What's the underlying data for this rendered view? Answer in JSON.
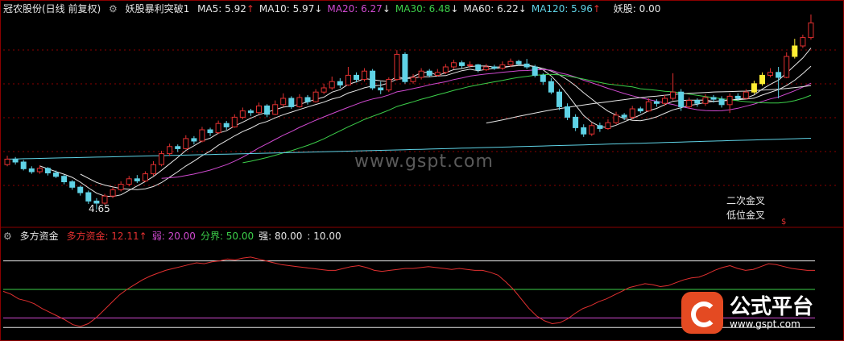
{
  "header": {
    "title": "冠农股份(日线 前复权)",
    "indicator_name": "妖股暴利突破1",
    "ma_items": [
      {
        "label": "MA5: 5.92",
        "arrow": "↑",
        "color": "#e6e6e6"
      },
      {
        "label": "MA10: 5.97",
        "arrow": "↓",
        "color": "#e6e6e6"
      },
      {
        "label": "MA20: 6.27",
        "arrow": "↓",
        "color": "#d04ad0"
      },
      {
        "label": "MA30: 6.48",
        "arrow": "↓",
        "color": "#3ccf4a"
      },
      {
        "label": "MA60: 6.22",
        "arrow": "↓",
        "color": "#e6e6e6"
      },
      {
        "label": "MA120: 5.96",
        "arrow": "↑",
        "color": "#5fd3e6"
      }
    ],
    "yaogu": "妖股: 0.00"
  },
  "sub_header": {
    "indicator_name": "多方资金",
    "items": [
      {
        "label": "多方资金: 12.11",
        "arrow": "↑",
        "color": "#e23030"
      },
      {
        "label": "弱: 20.00",
        "arrow": "",
        "color": "#d04ad0"
      },
      {
        "label": "分界: 50.00",
        "arrow": "",
        "color": "#3ccf4a"
      },
      {
        "label": "强: 80.00",
        "arrow": "",
        "color": "#e6e6e6"
      },
      {
        "label": ": 10.00",
        "arrow": "",
        "color": "#e6e6e6"
      }
    ]
  },
  "annotations": {
    "low_price": "4.65",
    "signal_1": "二次金叉",
    "signal_2": "低位金叉",
    "dollar": "$"
  },
  "watermark": "www.gspt.com",
  "logo": {
    "name": "公式平台",
    "url": "www.gspt.com"
  },
  "colors": {
    "up": "#e23030",
    "down": "#5fd3e6",
    "signal": "#ffee33",
    "grid": "#8b0000"
  },
  "chart_data": {
    "type": "candlestick",
    "price_range": [
      4.3,
      9.3
    ],
    "candles": [
      [
        5.72,
        5.85,
        5.93,
        5.68
      ],
      [
        5.85,
        5.78,
        5.9,
        5.72
      ],
      [
        5.78,
        5.62,
        5.83,
        5.58
      ],
      [
        5.62,
        5.55,
        5.68,
        5.5
      ],
      [
        5.55,
        5.63,
        5.7,
        5.5
      ],
      [
        5.63,
        5.52,
        5.66,
        5.46
      ],
      [
        5.52,
        5.44,
        5.58,
        5.4
      ],
      [
        5.44,
        5.31,
        5.48,
        5.25
      ],
      [
        5.31,
        5.18,
        5.35,
        5.12
      ],
      [
        5.18,
        5.05,
        5.22,
        4.98
      ],
      [
        5.05,
        4.85,
        5.1,
        4.78
      ],
      [
        4.85,
        4.8,
        4.92,
        4.65
      ],
      [
        4.8,
        4.97,
        5.02,
        4.76
      ],
      [
        4.97,
        5.12,
        5.18,
        4.92
      ],
      [
        5.12,
        5.25,
        5.32,
        5.08
      ],
      [
        5.25,
        5.38,
        5.45,
        5.2
      ],
      [
        5.38,
        5.33,
        5.47,
        5.28
      ],
      [
        5.33,
        5.5,
        5.56,
        5.3
      ],
      [
        5.5,
        5.72,
        5.8,
        5.45
      ],
      [
        5.72,
        5.98,
        6.05,
        5.68
      ],
      [
        5.98,
        6.15,
        6.22,
        5.92
      ],
      [
        6.15,
        6.1,
        6.2,
        6.02
      ],
      [
        6.1,
        6.34,
        6.42,
        6.08
      ],
      [
        6.34,
        6.28,
        6.4,
        6.2
      ],
      [
        6.28,
        6.55,
        6.62,
        6.25
      ],
      [
        6.55,
        6.48,
        6.6,
        6.4
      ],
      [
        6.48,
        6.7,
        6.77,
        6.45
      ],
      [
        6.7,
        6.62,
        6.76,
        6.55
      ],
      [
        6.62,
        6.85,
        6.92,
        6.6
      ],
      [
        6.85,
        7.0,
        7.08,
        6.8
      ],
      [
        7.0,
        6.96,
        7.05,
        6.88
      ],
      [
        6.96,
        7.12,
        7.2,
        6.92
      ],
      [
        7.12,
        6.92,
        7.16,
        6.85
      ],
      [
        6.92,
        7.15,
        7.25,
        6.9
      ],
      [
        7.15,
        7.3,
        7.42,
        7.1
      ],
      [
        7.3,
        7.1,
        7.35,
        7.05
      ],
      [
        7.1,
        7.32,
        7.4,
        7.08
      ],
      [
        7.32,
        7.22,
        7.38,
        7.15
      ],
      [
        7.22,
        7.45,
        7.52,
        7.2
      ],
      [
        7.45,
        7.55,
        7.65,
        7.4
      ],
      [
        7.55,
        7.7,
        7.82,
        7.5
      ],
      [
        7.7,
        7.62,
        7.78,
        7.55
      ],
      [
        7.62,
        7.85,
        8.05,
        7.6
      ],
      [
        7.85,
        7.75,
        7.92,
        7.68
      ],
      [
        7.75,
        7.95,
        8.02,
        7.7
      ],
      [
        7.95,
        7.55,
        8.0,
        7.5
      ],
      [
        7.55,
        7.5,
        7.7,
        7.4
      ],
      [
        7.5,
        7.75,
        7.8,
        7.45
      ],
      [
        7.75,
        8.35,
        8.45,
        7.72
      ],
      [
        8.35,
        7.7,
        8.4,
        7.65
      ],
      [
        7.7,
        7.8,
        7.88,
        7.65
      ],
      [
        7.8,
        7.95,
        8.02,
        7.75
      ],
      [
        7.95,
        7.85,
        8.0,
        7.8
      ],
      [
        7.85,
        7.92,
        8.0,
        7.82
      ],
      [
        7.92,
        8.05,
        8.12,
        7.88
      ],
      [
        8.05,
        8.15,
        8.22,
        8.0
      ],
      [
        8.15,
        8.08,
        8.2,
        8.02
      ],
      [
        8.08,
        8.1,
        8.18,
        8.03
      ],
      [
        8.1,
        7.98,
        8.12,
        7.92
      ],
      [
        7.98,
        8.05,
        8.12,
        7.95
      ],
      [
        8.05,
        8.02,
        8.1,
        7.98
      ],
      [
        8.02,
        8.1,
        8.18,
        7.98
      ],
      [
        8.1,
        8.18,
        8.25,
        8.05
      ],
      [
        8.18,
        8.12,
        8.22,
        8.08
      ],
      [
        8.12,
        8.05,
        8.24,
        8.0
      ],
      [
        8.05,
        7.85,
        8.1,
        7.8
      ],
      [
        7.85,
        7.7,
        7.9,
        7.62
      ],
      [
        7.7,
        7.45,
        7.78,
        7.4
      ],
      [
        7.45,
        7.1,
        7.52,
        7.02
      ],
      [
        7.1,
        6.85,
        7.18,
        6.78
      ],
      [
        6.85,
        6.6,
        6.92,
        6.52
      ],
      [
        6.6,
        6.45,
        6.68,
        6.38
      ],
      [
        6.45,
        6.65,
        6.72,
        6.4
      ],
      [
        6.65,
        6.58,
        6.72,
        6.5
      ],
      [
        6.58,
        6.72,
        6.8,
        6.55
      ],
      [
        6.72,
        6.9,
        6.98,
        6.68
      ],
      [
        6.9,
        6.85,
        6.95,
        6.78
      ],
      [
        6.85,
        7.05,
        7.12,
        6.8
      ],
      [
        7.05,
        7.0,
        7.1,
        6.95
      ],
      [
        7.0,
        7.22,
        7.3,
        6.98
      ],
      [
        7.22,
        7.18,
        7.28,
        7.1
      ],
      [
        7.18,
        7.3,
        7.38,
        7.12
      ],
      [
        7.3,
        7.45,
        7.9,
        7.25
      ],
      [
        7.45,
        7.1,
        7.52,
        7.0
      ],
      [
        7.1,
        7.25,
        7.32,
        7.05
      ],
      [
        7.25,
        7.18,
        7.3,
        7.1
      ],
      [
        7.18,
        7.32,
        7.4,
        7.12
      ],
      [
        7.32,
        7.28,
        7.38,
        7.2
      ],
      [
        7.28,
        7.15,
        7.35,
        7.08
      ],
      [
        7.15,
        7.35,
        7.42,
        6.95
      ],
      [
        7.35,
        7.3,
        7.42,
        7.25
      ],
      [
        7.3,
        7.45,
        7.52,
        7.28
      ],
      [
        7.45,
        7.65,
        7.72,
        7.4
      ],
      [
        7.65,
        7.85,
        7.92,
        7.6
      ],
      [
        7.85,
        7.92,
        8.02,
        7.8
      ],
      [
        7.92,
        7.8,
        8.05,
        7.3
      ],
      [
        7.8,
        8.3,
        8.4,
        7.78
      ],
      [
        8.3,
        8.55,
        8.72,
        8.25
      ],
      [
        8.55,
        8.75,
        8.82,
        8.5
      ],
      [
        8.75,
        9.1,
        9.3,
        8.7
      ]
    ],
    "signal_bars": [
      92,
      93,
      97
    ],
    "fund_line": [
      48,
      45,
      40,
      38,
      35,
      30,
      26,
      22,
      18,
      13,
      11,
      14,
      20,
      28,
      36,
      44,
      50,
      55,
      60,
      64,
      67,
      70,
      72,
      74,
      76,
      78,
      77,
      79,
      80,
      82,
      81,
      83,
      84,
      82,
      80,
      78,
      76,
      75,
      74,
      73,
      72,
      71,
      70,
      70,
      72,
      74,
      75,
      73,
      70,
      69,
      70,
      71,
      72,
      72,
      73,
      74,
      73,
      72,
      71,
      72,
      71,
      70,
      70,
      68,
      65,
      58,
      50,
      40,
      30,
      22,
      17,
      14,
      15,
      19,
      25,
      30,
      33,
      37,
      40,
      44,
      48,
      52,
      54,
      56,
      55,
      53,
      54,
      57,
      60,
      62,
      63,
      66,
      70,
      73,
      75,
      72,
      70,
      71,
      74,
      77,
      76,
      74,
      72,
      71,
      70,
      70
    ]
  }
}
